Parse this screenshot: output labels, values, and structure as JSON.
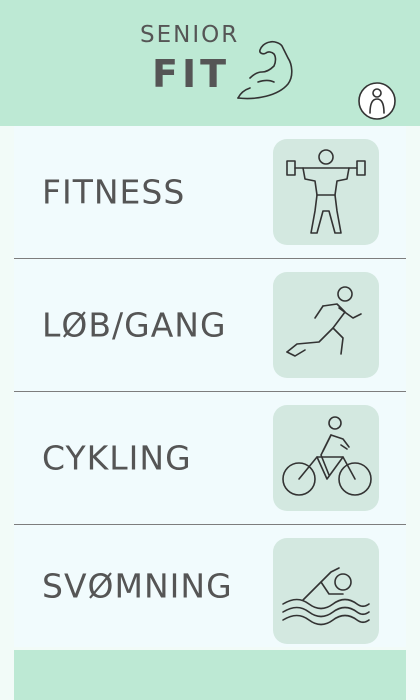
{
  "header": {
    "logo_top": "SENIOR",
    "logo_main": "FIT",
    "profile_icon": "user-profile-icon"
  },
  "categories": [
    {
      "label": "FITNESS",
      "icon": "weightlifter-icon"
    },
    {
      "label": "LØB/GANG",
      "icon": "runner-icon"
    },
    {
      "label": "CYKLING",
      "icon": "cyclist-icon"
    },
    {
      "label": "SVØMNING",
      "icon": "swimmer-icon"
    }
  ],
  "colors": {
    "header_bg": "#bde9d4",
    "list_bg": "#f1fbfd",
    "icon_tile": "#d3e8e0",
    "text": "#555555"
  }
}
